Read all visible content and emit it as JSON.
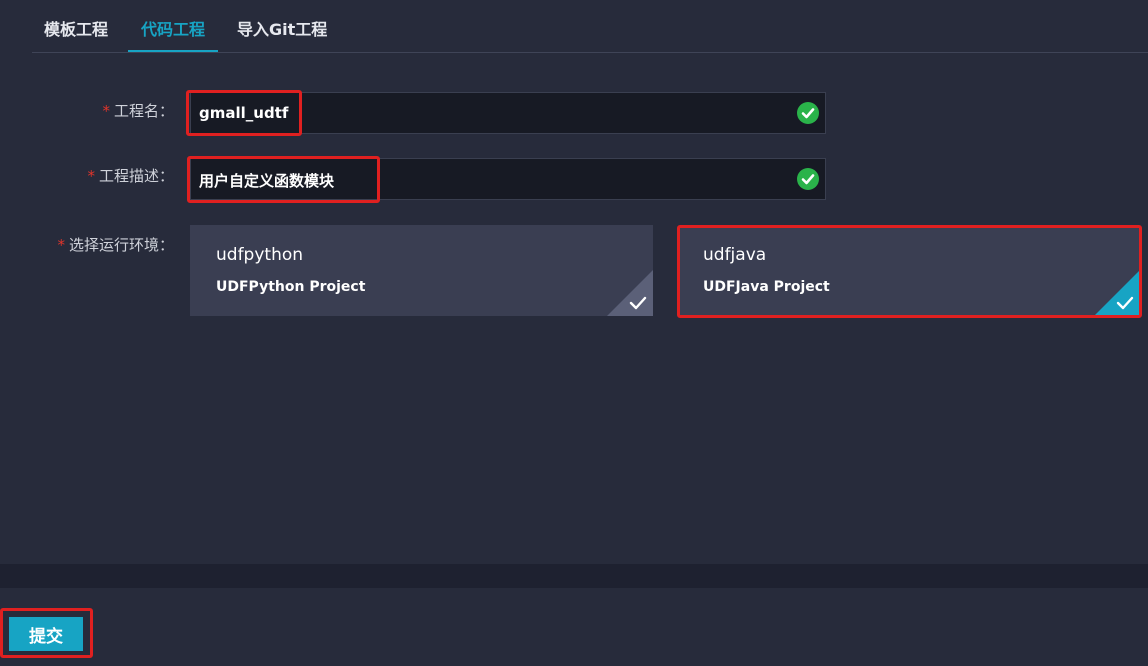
{
  "tabs": [
    {
      "label": "模板工程",
      "active": false
    },
    {
      "label": "代码工程",
      "active": true
    },
    {
      "label": "导入Git工程",
      "active": false
    }
  ],
  "form": {
    "required_mark": "*",
    "project_name": {
      "label": "工程名：",
      "value": "gmall_udtf",
      "status": "valid"
    },
    "project_desc": {
      "label": "工程描述：",
      "value": "用户自定义函数模块",
      "status": "valid"
    },
    "env": {
      "label": "选择运行环境：",
      "options": [
        {
          "title": "udfpython",
          "subtitle": "UDFPython Project",
          "selected": false
        },
        {
          "title": "udfjava",
          "subtitle": "UDFJava Project",
          "selected": true
        }
      ]
    }
  },
  "submit_label": "提交",
  "colors": {
    "accent": "#17a4c4",
    "valid": "#2ab34a",
    "highlight": "#e02020",
    "background": "#272b3b"
  }
}
